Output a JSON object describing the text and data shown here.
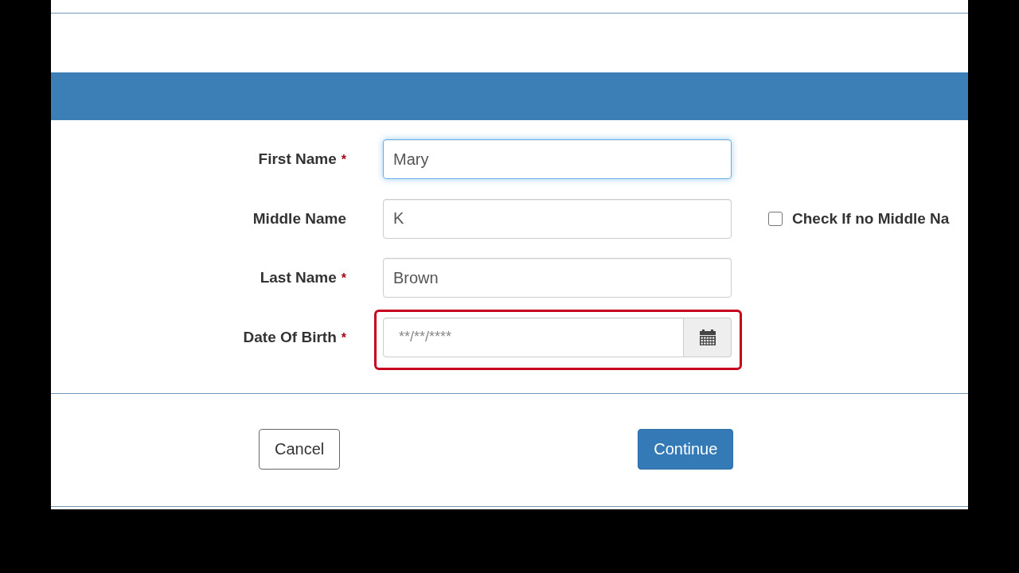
{
  "fields": [
    {
      "kind": "text",
      "label": "First Name",
      "required_mark": "*",
      "value": "Mary",
      "focused": true
    },
    {
      "kind": "text",
      "label": "Middle Name",
      "value": "K",
      "focused": false,
      "option": {
        "label": "Check If no Middle Na",
        "checked": false
      }
    },
    {
      "kind": "text",
      "label": "Last Name",
      "required_mark": "*",
      "value": "Brown",
      "focused": false
    },
    {
      "kind": "date",
      "label": "Date Of Birth",
      "required_mark": "*",
      "placeholder": "**/**/****",
      "focused": false,
      "highlighted": true
    }
  ],
  "buttons": [
    {
      "kind": "secondary",
      "label": "Cancel"
    },
    {
      "kind": "primary",
      "label": "Continue"
    }
  ]
}
